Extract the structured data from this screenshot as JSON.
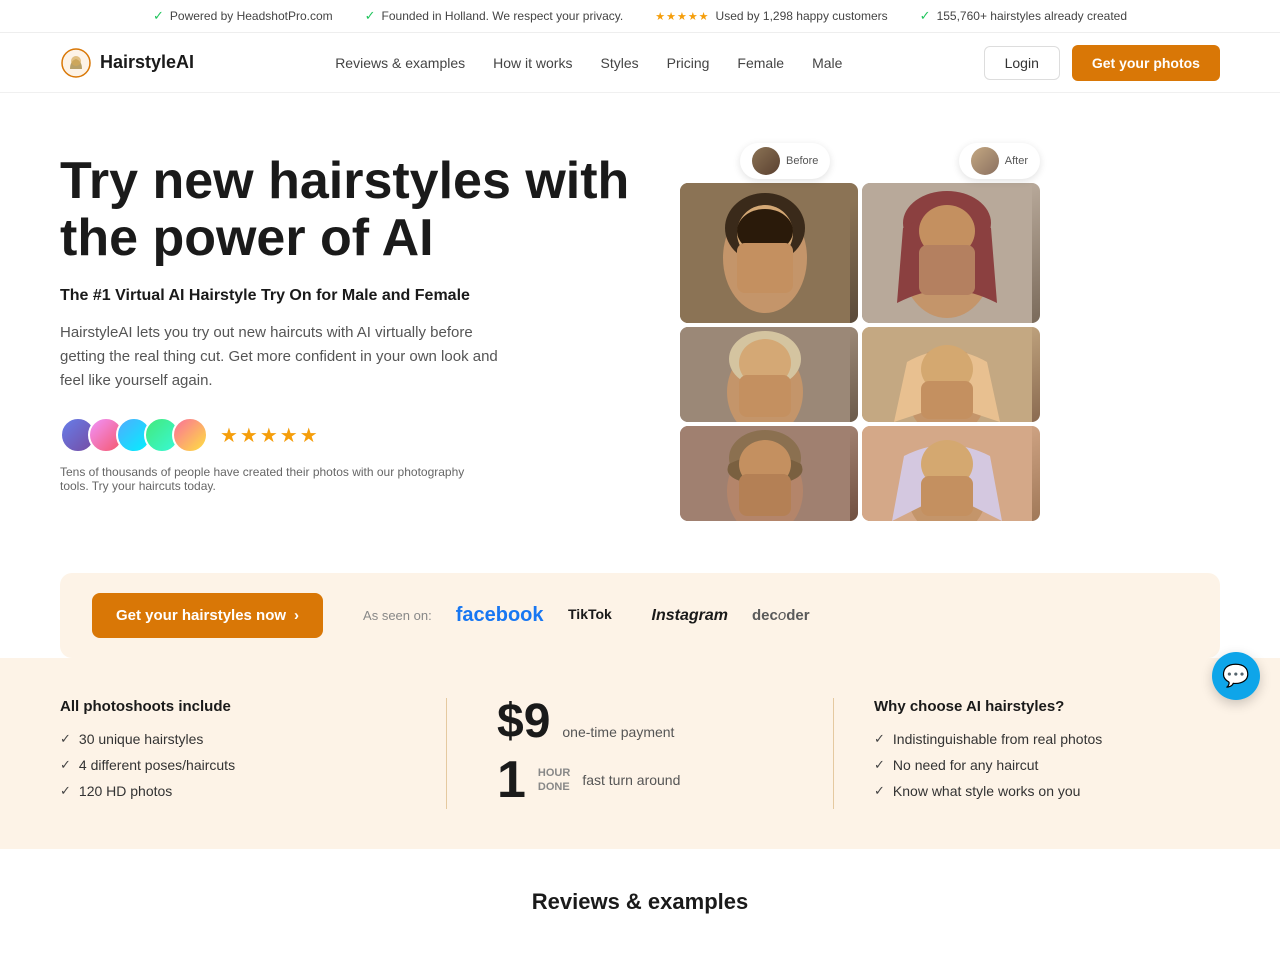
{
  "topbar": {
    "item1": "Powered by HeadshotPro.com",
    "item2": "Founded in Holland. We respect your privacy.",
    "item3": "Used by 1,298 happy customers",
    "item4": "155,760+ hairstyles already created"
  },
  "nav": {
    "logo_text": "HairstyleAI",
    "links": [
      "Reviews & examples",
      "How it works",
      "Styles",
      "Pricing",
      "Female",
      "Male"
    ],
    "login": "Login",
    "cta": "Get your photos"
  },
  "hero": {
    "title": "Try new hairstyles with the power of AI",
    "subtitle": "The #1 Virtual AI Hairstyle Try On for Male and Female",
    "description": "HairstyleAI lets you try out new haircuts with AI virtually before getting the real thing cut. Get more confident in your own look and feel like yourself again.",
    "social_proof": "Tens of thousands of people have created their photos with our photography tools. Try your haircuts today.",
    "ba_left": "Before",
    "ba_right": "After"
  },
  "cta_banner": {
    "button": "Get your hairstyles now",
    "as_seen_label": "As seen on:",
    "platforms": [
      "facebook",
      "TikTok",
      "Instagram",
      "decoder"
    ]
  },
  "features": {
    "col1": {
      "title": "All photoshoots include",
      "items": [
        "30 unique hairstyles",
        "4 different poses/haircuts",
        "120 HD photos"
      ]
    },
    "col2": {
      "price": "$9",
      "price_label": "one-time payment",
      "hour_num": "1",
      "hour_label1": "HOUR",
      "hour_label2": "DONE",
      "hour_desc": "fast turn around"
    },
    "col3": {
      "title": "Why choose AI hairstyles?",
      "items": [
        "Indistinguishable from real photos",
        "No need for any haircut",
        "Know what style works on you"
      ]
    }
  },
  "reviews_section": {
    "title": "Reviews & examples"
  },
  "chat": {
    "icon": "💬"
  }
}
